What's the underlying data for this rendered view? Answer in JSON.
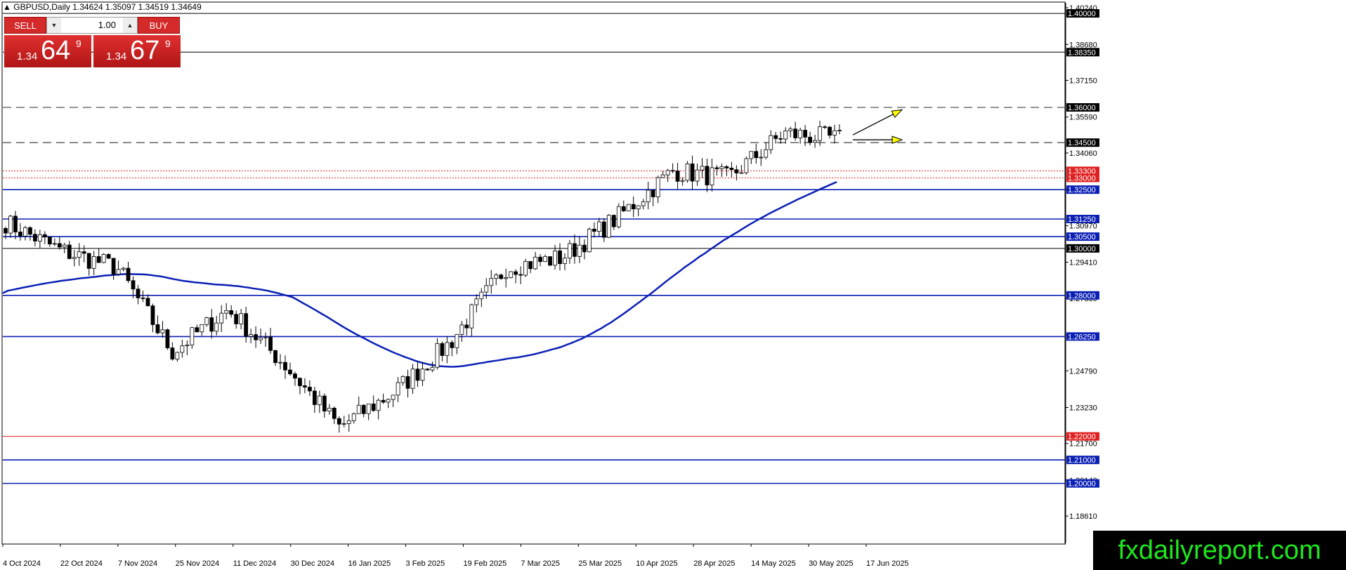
{
  "header": {
    "symbol_line": "GBPUSD,Daily  1.34624 1.35097 1.34519 1.34649"
  },
  "trade_panel": {
    "sell_label": "SELL",
    "buy_label": "BUY",
    "lot_value": "1.00",
    "sell_price_prefix": "1.34",
    "sell_price_big": "64",
    "sell_price_sup": "9",
    "buy_price_prefix": "1.34",
    "buy_price_big": "67",
    "buy_price_sup": "9"
  },
  "watermark": "fxdailyreport.com",
  "colors": {
    "bull": "#ffffff",
    "bear": "#000000",
    "blue_line": "#0a1fb4",
    "red_line": "#e02020",
    "ma_line": "#0a1fb4",
    "arrow_fill": "#ffff00"
  },
  "chart_data": {
    "type": "candlestick",
    "symbol": "GBPUSD",
    "timeframe": "Daily",
    "ylim": [
      1.1745,
      1.4045
    ],
    "y_ticks": [
      "1.40240",
      "1.38680",
      "1.37150",
      "1.35590",
      "1.34060",
      "1.32500",
      "1.30970",
      "1.29410",
      "1.27880",
      "1.26320",
      "1.24790",
      "1.23230",
      "1.21700",
      "1.20140",
      "1.18610"
    ],
    "x_labels": [
      "4 Oct 2024",
      "22 Oct 2024",
      "7 Nov 2024",
      "25 Nov 2024",
      "11 Dec 2024",
      "30 Dec 2024",
      "16 Jan 2025",
      "3 Feb 2025",
      "19 Feb 2025",
      "7 Mar 2025",
      "25 Mar 2025",
      "10 Apr 2025",
      "28 Apr 2025",
      "14 May 2025",
      "30 May 2025",
      "17 Jun 2025"
    ],
    "horizontal_levels": [
      {
        "price": 1.4,
        "label": "1.40000",
        "style": "solid",
        "color": "black"
      },
      {
        "price": 1.3835,
        "label": "1.38350",
        "style": "solid",
        "color": "black"
      },
      {
        "price": 1.36,
        "label": "1.36000",
        "style": "dashed",
        "color": "black"
      },
      {
        "price": 1.345,
        "label": "1.34500",
        "style": "dashed",
        "color": "black"
      },
      {
        "price": 1.333,
        "label": "1.33300",
        "style": "dotted",
        "color": "red"
      },
      {
        "price": 1.33,
        "label": "1.33000",
        "style": "dotted",
        "color": "red"
      },
      {
        "price": 1.325,
        "label": "1.32500",
        "style": "solid",
        "color": "blue"
      },
      {
        "price": 1.3125,
        "label": "1.31250",
        "style": "solid",
        "color": "blue"
      },
      {
        "price": 1.305,
        "label": "1.30500",
        "style": "solid",
        "color": "blue"
      },
      {
        "price": 1.3,
        "label": "1.30000",
        "style": "solid",
        "color": "black"
      },
      {
        "price": 1.28,
        "label": "1.28000",
        "style": "solid",
        "color": "blue"
      },
      {
        "price": 1.2625,
        "label": "1.26250",
        "style": "solid",
        "color": "blue"
      },
      {
        "price": 1.22,
        "label": "1.22000",
        "style": "solid",
        "color": "red"
      },
      {
        "price": 1.21,
        "label": "1.21000",
        "style": "solid",
        "color": "blue"
      },
      {
        "price": 1.2,
        "label": "1.20000",
        "style": "solid",
        "color": "blue"
      }
    ],
    "key_closes": [
      {
        "date": "4 Oct 2024",
        "close": 1.311
      },
      {
        "date": "22 Oct 2024",
        "close": 1.299
      },
      {
        "date": "7 Nov 2024",
        "close": 1.292
      },
      {
        "date": "25 Nov 2024",
        "close": 1.256
      },
      {
        "date": "11 Dec 2024",
        "close": 1.274
      },
      {
        "date": "30 Dec 2024",
        "close": 1.251
      },
      {
        "date": "16 Jan 2025",
        "close": 1.224
      },
      {
        "date": "3 Feb 2025",
        "close": 1.239
      },
      {
        "date": "19 Feb 2025",
        "close": 1.26
      },
      {
        "date": "7 Mar 2025",
        "close": 1.292
      },
      {
        "date": "25 Mar 2025",
        "close": 1.296
      },
      {
        "date": "10 Apr 2025",
        "close": 1.313
      },
      {
        "date": "28 Apr 2025",
        "close": 1.333
      },
      {
        "date": "14 May 2025",
        "close": 1.33
      },
      {
        "date": "30 May 2025",
        "close": 1.349
      },
      {
        "date": "17 Jun 2025",
        "close": 1.3465
      }
    ]
  }
}
